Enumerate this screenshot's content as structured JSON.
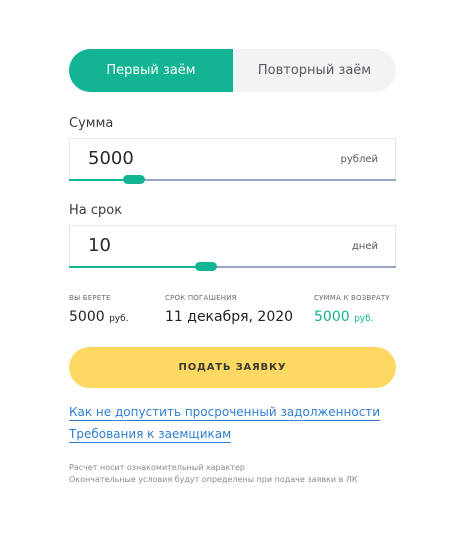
{
  "tabs": {
    "first": "Первый заём",
    "repeat": "Повторный заём"
  },
  "amount": {
    "label": "Сумма",
    "value": "5000",
    "unit": "рублей",
    "slider_fraction": 0.2
  },
  "term": {
    "label": "На срок",
    "value": "10",
    "unit": "дней",
    "slider_fraction": 0.42
  },
  "summary": {
    "take_caption": "ВЫ БЕРЕТЕ",
    "take_value": "5000",
    "take_unit": "руб.",
    "due_caption": "СРОК ПОГАШЕНИЯ",
    "due_value": "11 декабря, 2020",
    "return_caption": "СУММА К ВОЗВРАТУ",
    "return_value": "5000",
    "return_unit": "руб."
  },
  "submit_label": "ПОДАТЬ ЗАЯВКУ",
  "links": {
    "overdue": "Как не допустить просроченный задолженности",
    "requirements": "Требования к заемщикам"
  },
  "note": {
    "line1": "Расчет носит ознакомительный характер",
    "line2": "Окончательные условия будут определены при подаче заявки в ЛК"
  },
  "colors": {
    "accent": "#12b494",
    "button": "#fdd964",
    "link": "#2f7fd0"
  }
}
